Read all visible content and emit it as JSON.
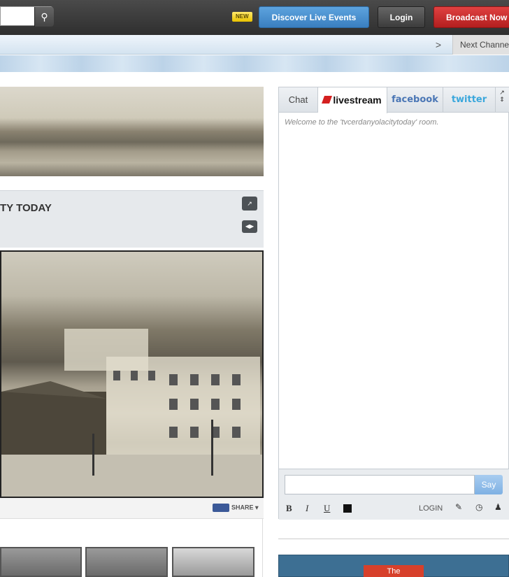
{
  "topbar": {
    "new_badge": "NEW",
    "discover_label": "Discover Live Events",
    "login_label": "Login",
    "broadcast_label": "Broadcast Now"
  },
  "subbar": {
    "next_arrow": ">",
    "next_channel_label": "Next Channel"
  },
  "player": {
    "channel_title": "TY TODAY",
    "share_label": "SHARE ▾"
  },
  "chat": {
    "tabs": [
      "Chat",
      "livestream",
      "facebook",
      "twitter"
    ],
    "welcome": "Welcome to the 'tvcerdanyolacitytoday' room.",
    "say_label": "Say",
    "format": {
      "bold": "B",
      "italic": "I",
      "underline": "U"
    },
    "login_label": "LOGIN"
  },
  "promo": {
    "tag": "The"
  }
}
